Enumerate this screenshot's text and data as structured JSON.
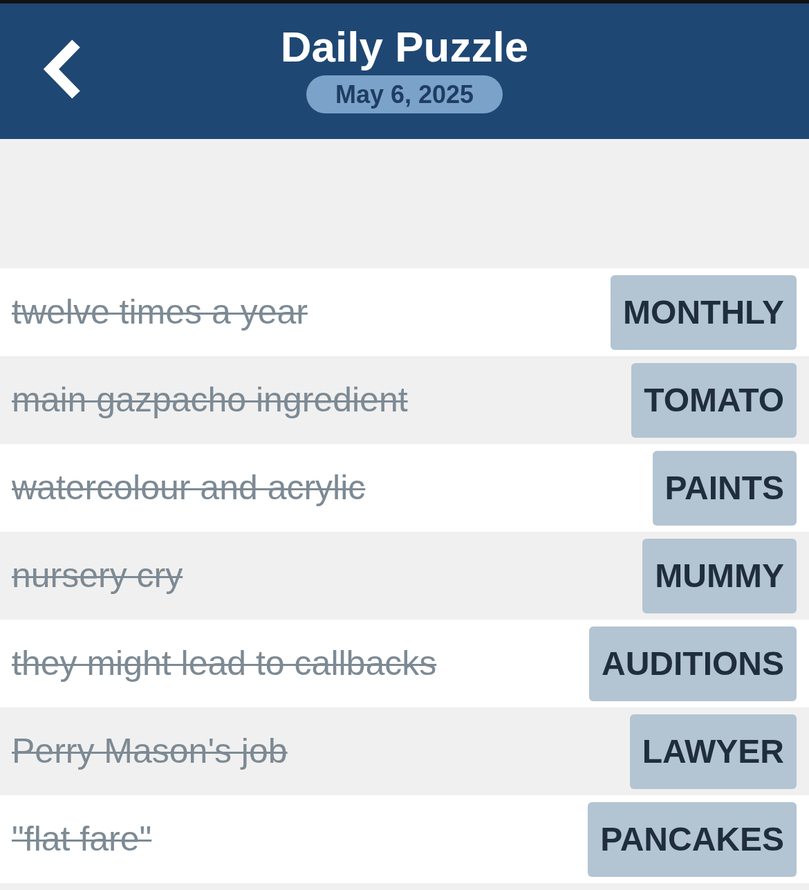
{
  "header": {
    "title": "Daily Puzzle",
    "date": "May 6, 2025"
  },
  "clues": [
    {
      "clue": "twelve times a year",
      "answer": "MONTHLY",
      "solved": true
    },
    {
      "clue": "main gazpacho ingredient",
      "answer": "TOMATO",
      "solved": true
    },
    {
      "clue": "watercolour and acrylic",
      "answer": "PAINTS",
      "solved": true
    },
    {
      "clue": "nursery cry",
      "answer": "MUMMY",
      "solved": true
    },
    {
      "clue": "they might lead to callbacks",
      "answer": "AUDITIONS",
      "solved": true
    },
    {
      "clue": "Perry Mason's job",
      "answer": "LAWYER",
      "solved": true
    },
    {
      "clue": "\"flat fare\"",
      "answer": "PANCAKES",
      "solved": true
    }
  ]
}
